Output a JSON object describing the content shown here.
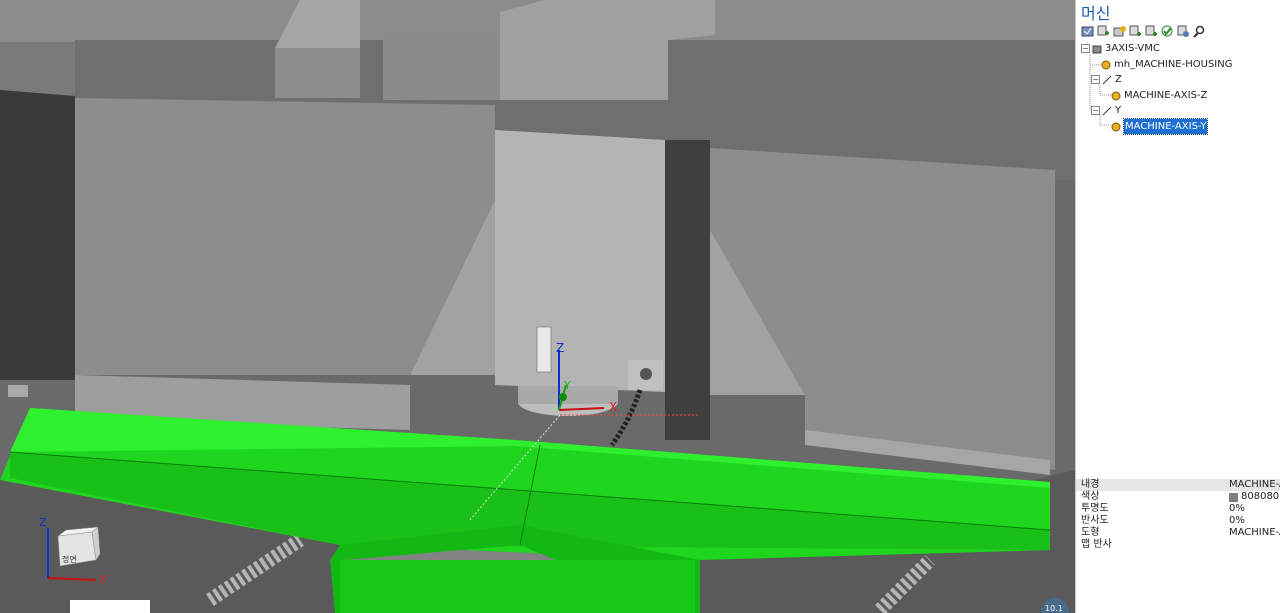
{
  "panel": {
    "title": "머신",
    "toolbar": [
      {
        "icon": "machine-properties-icon"
      },
      {
        "icon": "add-machine-icon"
      },
      {
        "icon": "add-housing-icon"
      },
      {
        "icon": "add-axis-icon"
      },
      {
        "icon": "add-axis-alt-icon"
      },
      {
        "icon": "check-icon"
      },
      {
        "icon": "settings-icon"
      },
      {
        "icon": "search-icon"
      }
    ],
    "tree": {
      "root": "3AXIS-VMC",
      "housing": "mh_MACHINE-HOUSING",
      "z_axis": "Z",
      "z_component": "MACHINE-AXIS-Z",
      "y_axis": "Y",
      "y_component": "MACHINE-AXIS-Y"
    }
  },
  "properties": {
    "rows": [
      {
        "key": "내경",
        "value": "MACHINE-A"
      },
      {
        "key": "색상",
        "value": "808080",
        "swatch": "#808080"
      },
      {
        "key": "투명도",
        "value": "0%"
      },
      {
        "key": "반사도",
        "value": "0%"
      },
      {
        "key": "도형",
        "value": "MACHINE-A"
      },
      {
        "key": "맵 반사",
        "value": ""
      }
    ]
  },
  "viewport": {
    "gizmo": {
      "x": "X",
      "y": "Y",
      "z": "Z"
    },
    "view_cube": {
      "face_label": "정면",
      "x": "X",
      "z": "Z"
    },
    "corner_badge": "10.1",
    "colors": {
      "highlight": "#1ee81e",
      "housing": "#8a8a8a",
      "background": "#6a6a6a"
    }
  }
}
